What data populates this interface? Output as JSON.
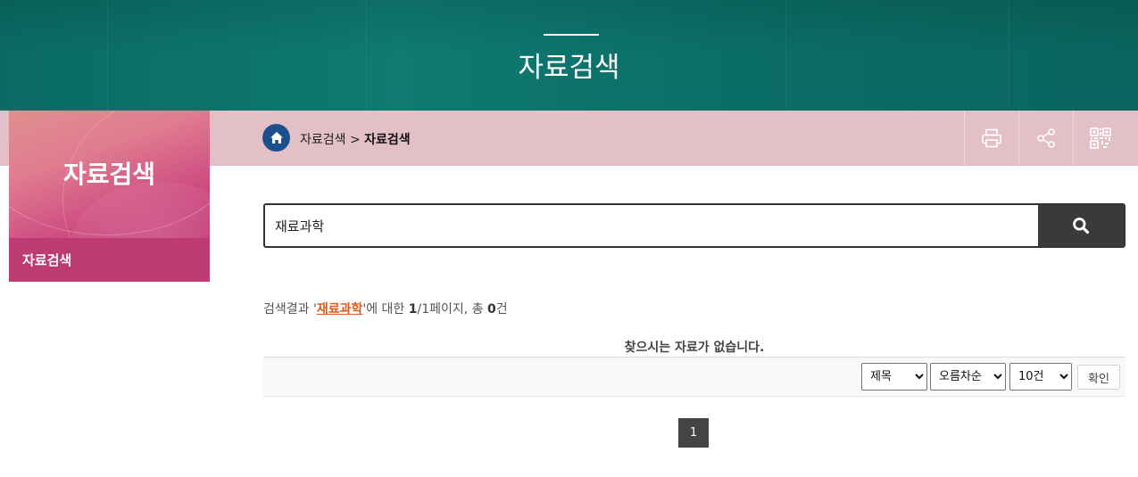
{
  "banner": {
    "title": "자료검색"
  },
  "breadcrumb": {
    "path": "자료검색",
    "separator": ">",
    "current": "자료검색"
  },
  "toolbar": {
    "print_icon": "print-icon",
    "share_icon": "share-icon",
    "qr_icon": "qr-code-icon"
  },
  "sidebar": {
    "title": "자료검색",
    "items": [
      {
        "label": "자료검색"
      }
    ]
  },
  "search": {
    "value": "재료과학",
    "button_icon": "search-icon"
  },
  "results": {
    "prefix": "검색결과 '",
    "keyword": "재료과학",
    "middle": "'에 대한 ",
    "page_current": "1",
    "page_sep": "/1페이지, 총 ",
    "total": "0",
    "suffix": "건",
    "empty_message": "찾으시는 자료가 없습니다."
  },
  "controls": {
    "sort_field": "제목",
    "sort_order": "오름차순",
    "page_size": "10건",
    "confirm_label": "확인"
  },
  "pagination": {
    "pages": [
      "1"
    ],
    "current": "1"
  },
  "colors": {
    "banner": "#0b6e66",
    "crumb_bar": "#e3c0c8",
    "side_menu": "#bd3a73",
    "search_button": "#3a3a3a",
    "keyword": "#e05a1a"
  }
}
